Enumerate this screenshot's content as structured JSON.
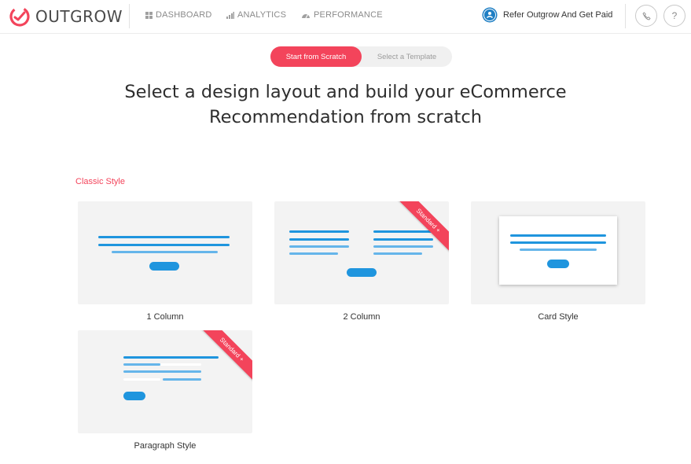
{
  "brand": {
    "name": "OUTGROW",
    "accent": "#f3445b",
    "blue": "#1f95de"
  },
  "nav": [
    {
      "label": "DASHBOARD",
      "icon": "grid-icon"
    },
    {
      "label": "ANALYTICS",
      "icon": "bar-chart-icon"
    },
    {
      "label": "PERFORMANCE",
      "icon": "gauge-icon"
    }
  ],
  "refer": {
    "label": "Refer Outgrow And Get Paid",
    "icon": "people-icon"
  },
  "header_buttons": {
    "help_label": "?",
    "phone_icon": "phone-icon"
  },
  "toggle": {
    "active": "Start from Scratch",
    "inactive": "Select a Template"
  },
  "title": "Select a design layout and build your eCommerce Recommendation from scratch",
  "section_label": "Classic Style",
  "badge": "Standard +",
  "layouts": [
    {
      "label": "1 Column"
    },
    {
      "label": "2 Column"
    },
    {
      "label": "Card Style"
    },
    {
      "label": "Paragraph Style"
    }
  ]
}
